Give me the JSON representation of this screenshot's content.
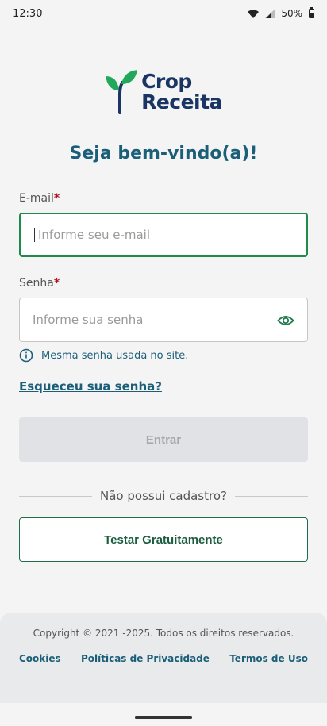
{
  "status_bar": {
    "time": "12:30",
    "battery": "50%",
    "icons": [
      "wifi-icon",
      "signal-icon",
      "battery-icon"
    ]
  },
  "logo": {
    "line1": "Crop",
    "line2": "Receita",
    "colors": {
      "leaf_green": "#22a85a",
      "text_navy": "#1a3463"
    }
  },
  "welcome": "Seja bem-vindo(a)!",
  "email": {
    "label": "E-mail",
    "required_mark": "*",
    "placeholder": "Informe seu e-mail"
  },
  "password": {
    "label": "Senha",
    "required_mark": "*",
    "placeholder": "Informe sua senha"
  },
  "hint": "Mesma senha usada no site.",
  "forgot_password": "Esqueceu sua senha?",
  "login_button": "Entrar",
  "divider_text": "Não possui cadastro?",
  "trial_button": "Testar Gratuitamente",
  "footer": {
    "copyright": "Copyright © 2021 -2025. Todos os direitos reservados.",
    "links": [
      "Cookies",
      "Políticas de Privacidade",
      "Termos de Uso"
    ]
  },
  "colors": {
    "primary_teal": "#1b5e78",
    "focus_green": "#1f8a4c",
    "required_red": "#b3121f",
    "disabled_bg": "#e1e2e5"
  }
}
